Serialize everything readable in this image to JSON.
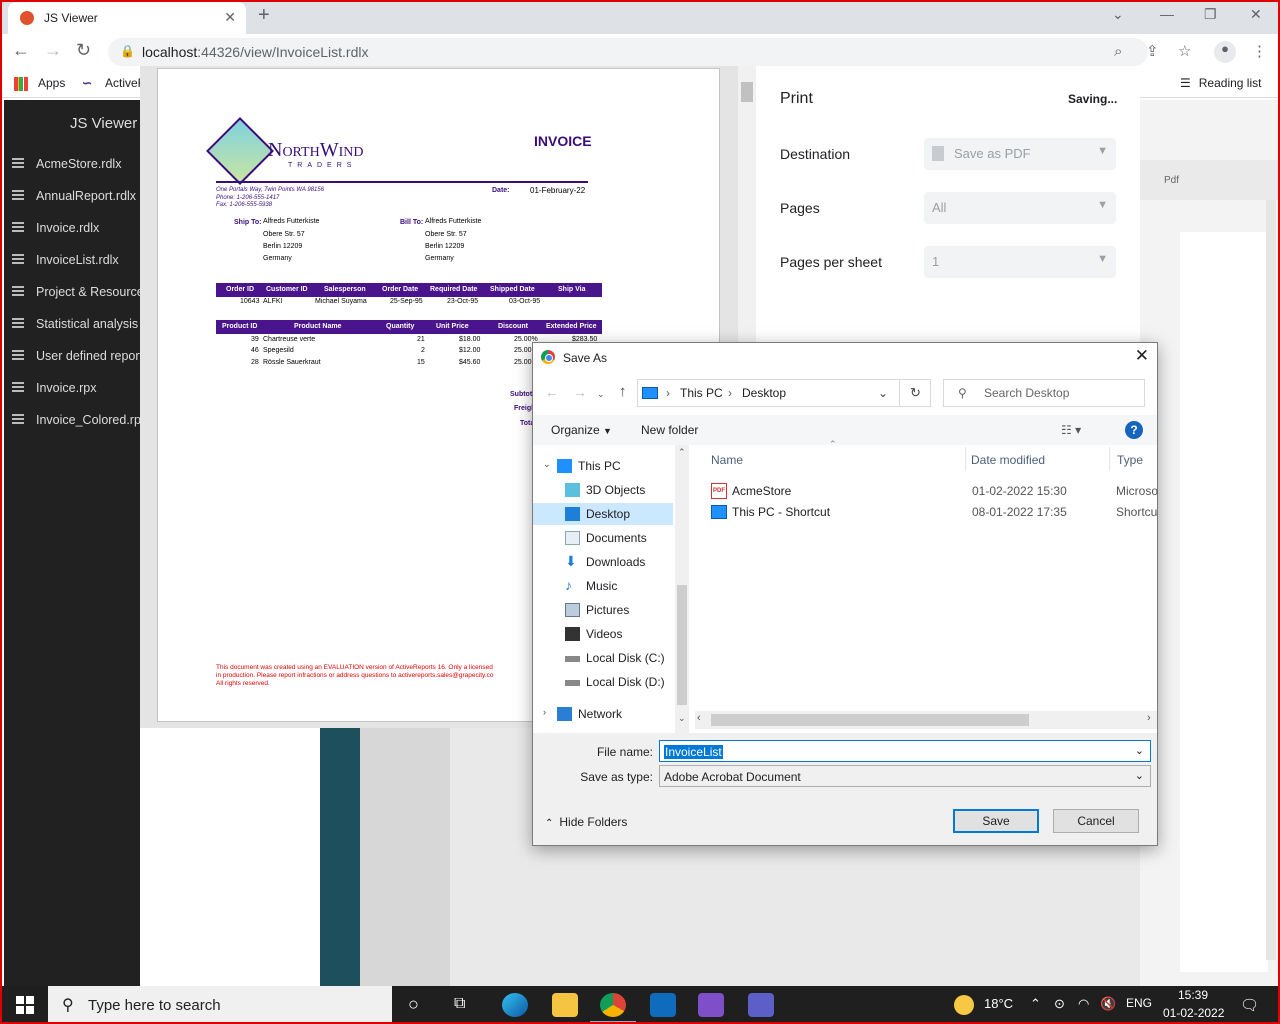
{
  "browser": {
    "tab_title": "JS Viewer",
    "url_host": "localhost",
    "url_rest": ":44326/view/InvoiceList.rdlx",
    "bookmarks": [
      {
        "label": "Apps"
      },
      {
        "label": "ActiveR"
      }
    ],
    "reading_list": "Reading list"
  },
  "sidebar": {
    "title": "JS Viewer",
    "items": [
      {
        "label": "AcmeStore.rdlx"
      },
      {
        "label": "AnnualReport.rdlx"
      },
      {
        "label": "Invoice.rdlx"
      },
      {
        "label": "InvoiceList.rdlx"
      },
      {
        "label": "Project & Resource"
      },
      {
        "label": "Statistical analysis s"
      },
      {
        "label": "User defined report"
      },
      {
        "label": "Invoice.rpx"
      },
      {
        "label": "Invoice_Colored.rpx"
      }
    ]
  },
  "right_pane": {
    "tab": "Pdf"
  },
  "invoice": {
    "brand_name": "NorthWind",
    "brand_sub": "TRADERS",
    "title": "INVOICE",
    "address": "One Portals Way, Twin Points WA  98156",
    "phone": "Phone: 1-206-555-1417",
    "fax": "Fax: 1-206-555-5938",
    "date_label": "Date:",
    "date": "01-February-22",
    "ship_label": "Ship To:",
    "bill_label": "Bill To:",
    "ship_lines": [
      "Alfreds Futterkiste",
      "Obere Str. 57",
      "Berlin  12209",
      "Germany"
    ],
    "bill_lines": [
      "Alfreds Futterkiste",
      "Obere Str. 57",
      "Berlin  12209",
      "Germany"
    ],
    "order_headers": [
      "Order ID",
      "Customer ID",
      "Salesperson",
      "Order Date",
      "Required Date",
      "Shipped Date",
      "Ship Via"
    ],
    "order_row": [
      "10643",
      "ALFKI",
      "Michael Suyama",
      "25-Sep-95",
      "23-Oct-95",
      "03-Oct-95"
    ],
    "item_headers": [
      "Product ID",
      "Product Name",
      "Quantity",
      "Unit Price",
      "Discount",
      "Extended Price"
    ],
    "items": [
      [
        "39",
        "Chartreuse verte",
        "21",
        "$18.00",
        "25.00%",
        "$283.50"
      ],
      [
        "46",
        "Spegesild",
        "2",
        "$12.00",
        "25.00",
        ""
      ],
      [
        "28",
        "Rössle Sauerkraut",
        "15",
        "$45.60",
        "25.00",
        ""
      ]
    ],
    "totals": [
      "Subtota",
      "Freigh",
      "Tota"
    ],
    "disclaimer": [
      "This document was created using an EVALUATION version of ActiveReports 16. Only a licensed",
      "in production. Please report infractions or address questions to activereports.sales@grapecity.co",
      "All rights reserved."
    ]
  },
  "print": {
    "title": "Print",
    "status": "Saving...",
    "destination_label": "Destination",
    "destination_value": "Save as PDF",
    "pages_label": "Pages",
    "pages_value": "All",
    "pps_label": "Pages per sheet",
    "pps_value": "1"
  },
  "dialog": {
    "title": "Save As",
    "path": [
      "This PC",
      "Desktop"
    ],
    "search_placeholder": "Search Desktop",
    "organize": "Organize",
    "new_folder": "New folder",
    "tree": [
      {
        "label": "This PC",
        "icon": "pc-icon"
      },
      {
        "label": "3D Objects",
        "icon": "cube-icon"
      },
      {
        "label": "Desktop",
        "icon": "desktop-icon"
      },
      {
        "label": "Documents",
        "icon": "document-icon"
      },
      {
        "label": "Downloads",
        "icon": "download-icon"
      },
      {
        "label": "Music",
        "icon": "music-icon"
      },
      {
        "label": "Pictures",
        "icon": "picture-icon"
      },
      {
        "label": "Videos",
        "icon": "video-icon"
      },
      {
        "label": "Local Disk (C:)",
        "icon": "disk-icon"
      },
      {
        "label": "Local Disk (D:)",
        "icon": "disk-icon"
      },
      {
        "label": "Network",
        "icon": "network-icon"
      }
    ],
    "columns": [
      "Name",
      "Date modified",
      "Type"
    ],
    "files": [
      {
        "name": "AcmeStore",
        "date": "01-02-2022 15:30",
        "type": "Microso",
        "icon": "pdf-icon"
      },
      {
        "name": "This PC - Shortcut",
        "date": "08-01-2022 17:35",
        "type": "Shortcu",
        "icon": "shortcut-icon"
      }
    ],
    "filename_label": "File name:",
    "filename": "InvoiceList",
    "savetype_label": "Save as type:",
    "savetype": "Adobe Acrobat Document",
    "hide_folders": "Hide Folders",
    "save": "Save",
    "cancel": "Cancel"
  },
  "taskbar": {
    "search_placeholder": "Type here to search",
    "temperature": "18°C",
    "language": "ENG",
    "time": "15:39",
    "date": "01-02-2022"
  }
}
